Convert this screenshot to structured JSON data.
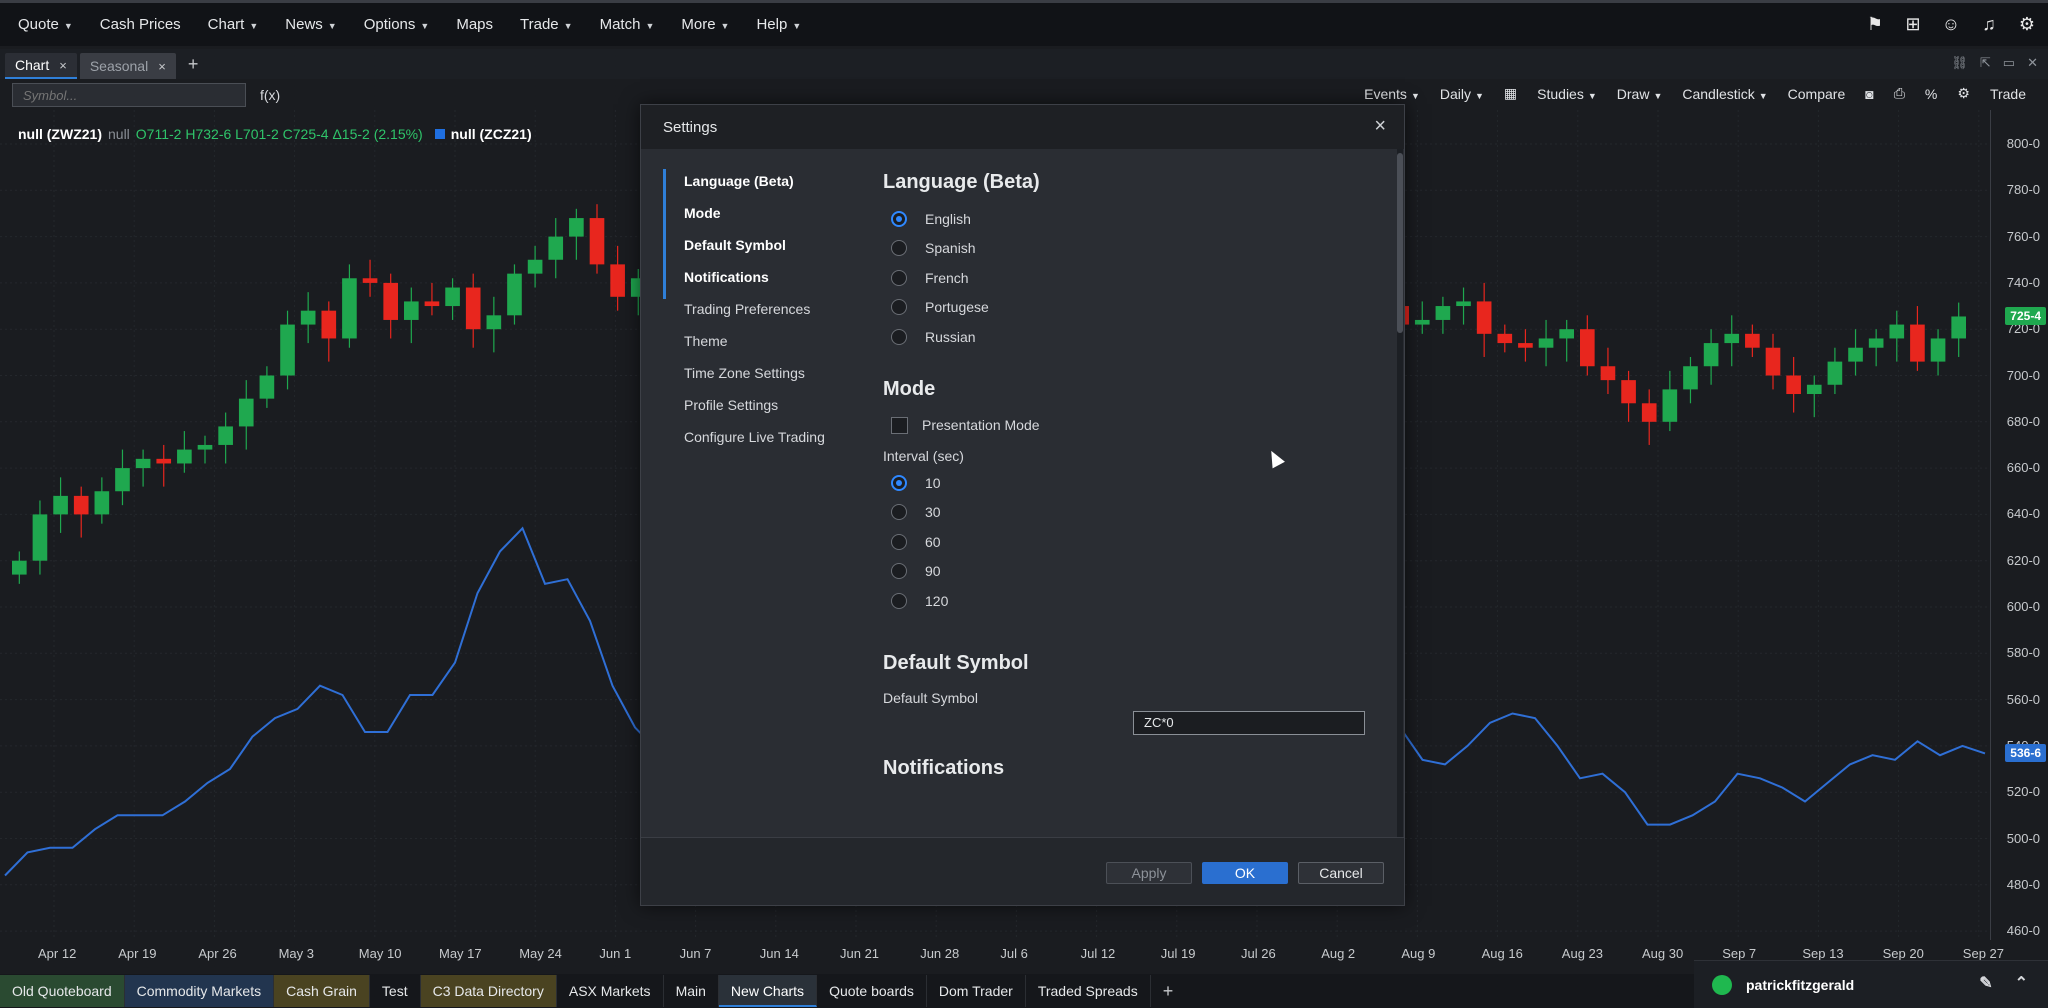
{
  "menu": [
    {
      "label": "Quote",
      "caret": true
    },
    {
      "label": "Cash Prices",
      "caret": false
    },
    {
      "label": "Chart",
      "caret": true
    },
    {
      "label": "News",
      "caret": true
    },
    {
      "label": "Options",
      "caret": true
    },
    {
      "label": "Maps",
      "caret": false
    },
    {
      "label": "Trade",
      "caret": true
    },
    {
      "label": "Match",
      "caret": true
    },
    {
      "label": "More",
      "caret": true
    },
    {
      "label": "Help",
      "caret": true
    }
  ],
  "top_icons": [
    "flag-icon",
    "grid-icon",
    "user-icon",
    "bell-icon",
    "gear-icon"
  ],
  "tabs": [
    {
      "label": "Chart",
      "active": true
    },
    {
      "label": "Seasonal",
      "active": false
    }
  ],
  "tab_add": "+",
  "toolbar": {
    "symbol_placeholder": "Symbol...",
    "fx": "f(x)",
    "items": [
      {
        "label": "Events",
        "caret": true
      },
      {
        "label": "Daily",
        "caret": true
      },
      {
        "label": "▦",
        "caret": false
      },
      {
        "label": "Studies",
        "caret": true
      },
      {
        "label": "Draw",
        "caret": true
      },
      {
        "label": "Candlestick",
        "caret": true
      },
      {
        "label": "Compare",
        "caret": false
      },
      {
        "label": "◙",
        "caret": false
      },
      {
        "label": "⎙",
        "caret": false
      },
      {
        "label": "%",
        "caret": false
      },
      {
        "label": "⚙",
        "caret": false
      },
      {
        "label": "Trade",
        "caret": false
      }
    ]
  },
  "legend": {
    "symbol1": "null (ZWZ21)",
    "null": "null",
    "ohlc": "O711-2 H732-6 L701-2 C725-4 Δ15-2 (2.15%)",
    "symbol2": "null (ZCZ21)"
  },
  "chart_data": {
    "type": "line",
    "price_axis_labels": [
      "800-0",
      "780-0",
      "760-0",
      "740-0",
      "720-0",
      "700-0",
      "680-0",
      "660-0",
      "640-0",
      "620-0",
      "600-0",
      "580-0",
      "560-0",
      "540-0",
      "520-0",
      "500-0",
      "480-0",
      "460-0"
    ],
    "date_labels": [
      "Apr 12",
      "Apr 19",
      "Apr 26",
      "May 3",
      "May 10",
      "May 17",
      "May 24",
      "Jun 1",
      "Jun 7",
      "Jun 14",
      "Jun 21",
      "Jun 28",
      "Jul 6",
      "Jul 12",
      "Jul 19",
      "Jul 26",
      "Aug 2",
      "Aug 9",
      "Aug 16",
      "Aug 23",
      "Aug 30",
      "Sep 7",
      "Sep 13",
      "Sep 20",
      "Sep 27"
    ],
    "last_price_ZWZ21": "725-4",
    "last_price_ZCZ21": "536-6",
    "colors": {
      "up": "#1fa84f",
      "down": "#e8261e",
      "line": "#2f6fd6",
      "tag_green": "#1fa84f",
      "tag_blue": "#2a6fd0"
    },
    "series": [
      {
        "name": "null (ZWZ21)",
        "style": "candlestick",
        "closes": [
          620,
          640,
          648,
          640,
          650,
          660,
          664,
          662,
          668,
          670,
          678,
          690,
          700,
          722,
          728,
          716,
          742,
          740,
          724,
          732,
          730,
          738,
          720,
          726,
          744,
          750,
          760,
          768,
          748,
          734,
          742,
          744,
          716,
          700,
          710,
          706,
          694,
          682,
          676,
          672,
          666,
          660,
          652,
          662,
          680,
          690,
          698,
          704,
          706,
          712,
          718,
          726,
          730,
          734,
          738,
          742,
          746,
          752,
          760,
          784,
          750,
          746,
          742,
          730,
          726,
          734,
          730,
          722,
          724,
          730,
          732,
          718,
          714,
          712,
          716,
          720,
          704,
          698,
          688,
          680,
          694,
          704,
          714,
          718,
          712,
          700,
          692,
          696,
          706,
          712,
          716,
          722,
          706,
          716,
          725.5
        ]
      },
      {
        "name": "null (ZCZ21)",
        "style": "line",
        "values": [
          484,
          494,
          496,
          496,
          504,
          510,
          510,
          510,
          516,
          524,
          530,
          544,
          552,
          556,
          566,
          562,
          546,
          546,
          562,
          562,
          576,
          606,
          624,
          634,
          610,
          612,
          594,
          566,
          548,
          538,
          546,
          540,
          552,
          546,
          540,
          516,
          522,
          552,
          558,
          568,
          580,
          600,
          612,
          608,
          574,
          576,
          570,
          568,
          562,
          556,
          552,
          548,
          540,
          532,
          544,
          556,
          560,
          568,
          574,
          574,
          566,
          562,
          548,
          534,
          532,
          540,
          550,
          554,
          552,
          540,
          526,
          528,
          520,
          506,
          506,
          510,
          516,
          528,
          526,
          522,
          516,
          524,
          532,
          536,
          534,
          542,
          536,
          540,
          536.75
        ]
      }
    ]
  },
  "dialog": {
    "title": "Settings",
    "close": "×",
    "nav": [
      {
        "label": "Language (Beta)",
        "bold": true
      },
      {
        "label": "Mode",
        "bold": true
      },
      {
        "label": "Default Symbol",
        "bold": true
      },
      {
        "label": "Notifications",
        "bold": true
      },
      {
        "label": "Trading Preferences",
        "bold": false
      },
      {
        "label": "Theme",
        "bold": false
      },
      {
        "label": "Time Zone Settings",
        "bold": false
      },
      {
        "label": "Profile Settings",
        "bold": false
      },
      {
        "label": "Configure Live Trading",
        "bold": false
      }
    ],
    "language": {
      "title": "Language (Beta)",
      "options": [
        {
          "label": "English",
          "checked": true
        },
        {
          "label": "Spanish",
          "checked": false
        },
        {
          "label": "French",
          "checked": false
        },
        {
          "label": "Portugese",
          "checked": false
        },
        {
          "label": "Russian",
          "checked": false
        }
      ]
    },
    "mode": {
      "title": "Mode",
      "presentation_label": "Presentation Mode",
      "presentation_checked": false,
      "interval_label": "Interval (sec)",
      "intervals": [
        {
          "label": "10",
          "checked": true
        },
        {
          "label": "30",
          "checked": false
        },
        {
          "label": "60",
          "checked": false
        },
        {
          "label": "90",
          "checked": false
        },
        {
          "label": "120",
          "checked": false
        }
      ]
    },
    "default_symbol": {
      "title": "Default Symbol",
      "label": "Default Symbol",
      "value": "ZC*0"
    },
    "notifications": {
      "title": "Notifications"
    },
    "buttons": {
      "apply": "Apply",
      "ok": "OK",
      "cancel": "Cancel"
    }
  },
  "bottom_tabs": [
    {
      "label": "Old Quoteboard",
      "style": "green"
    },
    {
      "label": "Commodity Markets",
      "style": "blue"
    },
    {
      "label": "Cash Grain",
      "style": "olive"
    },
    {
      "label": "Test",
      "style": "plain"
    },
    {
      "label": "C3 Data Directory",
      "style": "olive"
    },
    {
      "label": "ASX Markets",
      "style": "plain"
    },
    {
      "label": "Main",
      "style": "plain"
    },
    {
      "label": "New Charts",
      "style": "active"
    },
    {
      "label": "Quote boards",
      "style": "plain"
    },
    {
      "label": "Dom Trader",
      "style": "plain"
    },
    {
      "label": "Traded Spreads",
      "style": "plain"
    }
  ],
  "bottom_add": "+",
  "user": {
    "name": "patrickfitzgerald"
  }
}
